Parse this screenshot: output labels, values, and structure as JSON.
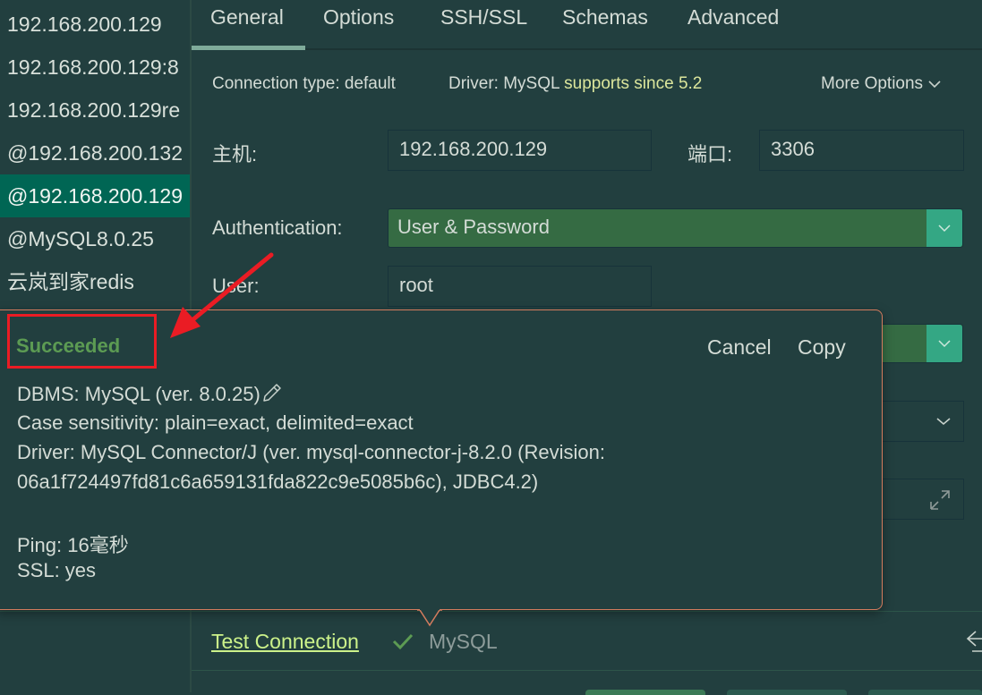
{
  "sidebar": {
    "items": [
      {
        "label": "192.168.200.129",
        "selected": false
      },
      {
        "label": "192.168.200.129:8",
        "selected": false
      },
      {
        "label": "192.168.200.129re",
        "selected": false
      },
      {
        "label": "@192.168.200.132",
        "selected": false
      },
      {
        "label": "@192.168.200.129",
        "selected": true
      },
      {
        "label": "@MySQL8.0.25",
        "selected": false
      },
      {
        "label": "云岚到家redis",
        "selected": false
      }
    ]
  },
  "tabs": [
    {
      "label": "General",
      "active": true
    },
    {
      "label": "Options",
      "active": false
    },
    {
      "label": "SSH/SSL",
      "active": false
    },
    {
      "label": "Schemas",
      "active": false
    },
    {
      "label": "Advanced",
      "active": false
    }
  ],
  "meta": {
    "connection_type": "Connection type: default",
    "driver_label": "Driver: MySQL",
    "driver_support": "supports since 5.2",
    "more_options": "More Options"
  },
  "form": {
    "host_label": "主机:",
    "host_value": "192.168.200.129",
    "port_label": "端口:",
    "port_value": "3306",
    "auth_label": "Authentication:",
    "auth_value": "User & Password",
    "user_label": "User:",
    "user_value": "root"
  },
  "popup": {
    "status": "Succeeded",
    "cancel": "Cancel",
    "copy": "Copy",
    "lines": [
      "DBMS: MySQL (ver. 8.0.25)",
      "Case sensitivity: plain=exact, delimited=exact",
      "Driver: MySQL Connector/J (ver. mysql-connector-j-8.2.0 (Revision:",
      "06a1f724497fd81c6a659131fda822c9e5085b6c), JDBC4.2)",
      "",
      "Ping: 16毫秒",
      "SSL: yes"
    ]
  },
  "footer": {
    "test_connection": "Test Connection",
    "driver_name": "MySQL"
  },
  "colors": {
    "background": "#223f3f",
    "selected": "#006654",
    "success": "#5c9b53",
    "link": "#ccf28a",
    "highlight": "#dce69c",
    "popup_border": "#d47c5e",
    "annotation": "#ea1c24"
  }
}
